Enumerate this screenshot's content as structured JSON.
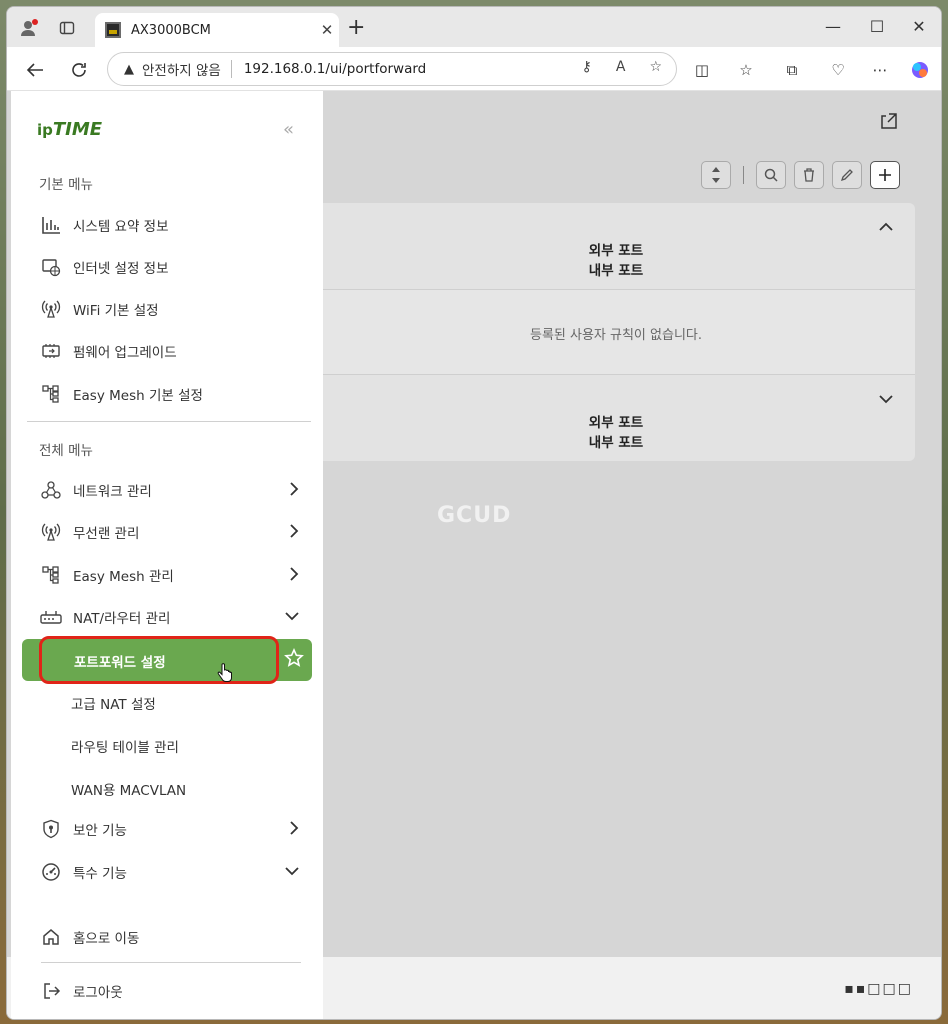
{
  "browser": {
    "tab_title": "AX3000BCM",
    "security_label": "안전하지 않음",
    "url": "192.168.0.1/ui/portforward"
  },
  "sidebar": {
    "logo_ip": "ip",
    "logo_time": "TIME",
    "basic_menu_title": "기본 메뉴",
    "basic_items": [
      {
        "label": "시스템 요약 정보",
        "icon": "bar-chart-icon"
      },
      {
        "label": "인터넷 설정 정보",
        "icon": "globe-window-icon"
      },
      {
        "label": "WiFi 기본 설정",
        "icon": "wifi-antenna-icon"
      },
      {
        "label": "펌웨어 업그레이드",
        "icon": "chip-icon"
      },
      {
        "label": "Easy Mesh 기본 설정",
        "icon": "mesh-tree-icon"
      }
    ],
    "all_menu_title": "전체 메뉴",
    "all_items": [
      {
        "label": "네트워크 관리",
        "icon": "network-icon",
        "expanded": false
      },
      {
        "label": "무선랜 관리",
        "icon": "wifi-antenna-icon",
        "expanded": false
      },
      {
        "label": "Easy Mesh 관리",
        "icon": "mesh-tree-icon",
        "expanded": false
      },
      {
        "label": "NAT/라우터 관리",
        "icon": "router-icon",
        "expanded": true
      }
    ],
    "nat_sub_items": [
      "포트포워드 설정",
      "고급 NAT 설정",
      "라우팅 테이블 관리",
      "WAN용 MACVLAN"
    ],
    "active_item": "포트포워드 설정",
    "bottom_items": [
      {
        "label": "보안 기능",
        "icon": "shield-lock-icon",
        "expanded": false
      },
      {
        "label": "특수 기능",
        "icon": "gauge-icon",
        "expanded": true
      }
    ],
    "home_label": "홈으로 이동",
    "logout_label": "로그아웃"
  },
  "main": {
    "col_external": "외부 포트",
    "col_internal": "내부 포트",
    "empty_message": "등록된 사용자 규칙이 없습니다.",
    "watermark": "GCUD",
    "pager": "▪▪□□□"
  },
  "colors": {
    "accent_green": "#6aa84f",
    "highlight_red": "#e02418"
  }
}
